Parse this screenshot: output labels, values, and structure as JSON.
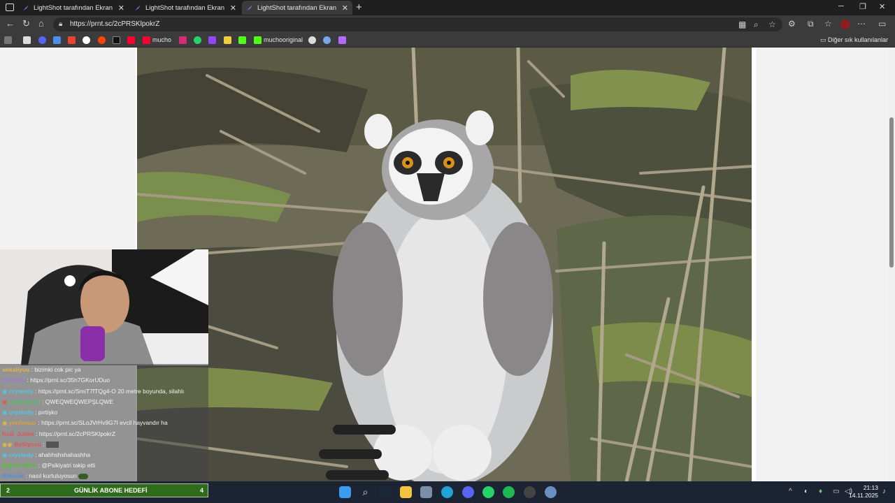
{
  "tabs": [
    {
      "label": "LightShot tarafından Ekran Görün",
      "active": false
    },
    {
      "label": "LightShot tarafından Ekran Görün",
      "active": false
    },
    {
      "label": "LightShot tarafından Ekran Görün",
      "active": true
    }
  ],
  "address": {
    "url": "https://prnt.sc/2cPRSKlpokrZ"
  },
  "bookmarks": {
    "items": [
      {
        "label": "mucho",
        "icon": "youtube-icon"
      },
      {
        "label": "muchooriginal",
        "icon": "kick-icon"
      }
    ],
    "other_label": "Diğer sık kullanılanlar"
  },
  "chat": [
    {
      "user": "ankaliyou",
      "text": ": bizimki cok pic ya",
      "color": "#e2b64a"
    },
    {
      "user": "0Pr1d3c",
      "text": ": https://prnt.sc/35h7GKorUDuo",
      "color": "#9c7be0"
    },
    {
      "user": "crystedy",
      "text": ": https://prnt.sc/SmiT7fTQg4-O 20 metre boyunda, silahlı",
      "color": "#56c4e8"
    },
    {
      "user": "ovuealnrxe",
      "text": ": QWEQWEQWEPŞLQWE",
      "color": "#4bc46a"
    },
    {
      "user": "crystedy",
      "text": ": pırtişko",
      "color": "#56c4e8"
    },
    {
      "user": "yenforeur",
      "text": ": https://prnt.sc/SLoJVrHv9G7I evcil hayvandır ha",
      "color": "#d9a23a"
    },
    {
      "user": "Kral_Julien",
      "text": ": https://prnt.sc/2cPRSKlpokrZ",
      "color": "#e05555"
    },
    {
      "user": "BySlycon",
      "text": ":",
      "color": "#e05555"
    },
    {
      "user": "crystedy",
      "text": ": ahahhshshahashha",
      "color": "#56c4e8"
    },
    {
      "user": "KickBot",
      "text": ": @Psikiyatri takip etti",
      "color": "#53c23b"
    },
    {
      "user": "Rebonk",
      "text": ": nasıl kurtuluyosun",
      "color": "#4d8fe0"
    }
  ],
  "goal": {
    "current": "2",
    "label": "GÜNLİK ABONE HEDEFİ",
    "target": "4"
  },
  "clock": {
    "time": "21:13",
    "date": "14.11.2025"
  }
}
